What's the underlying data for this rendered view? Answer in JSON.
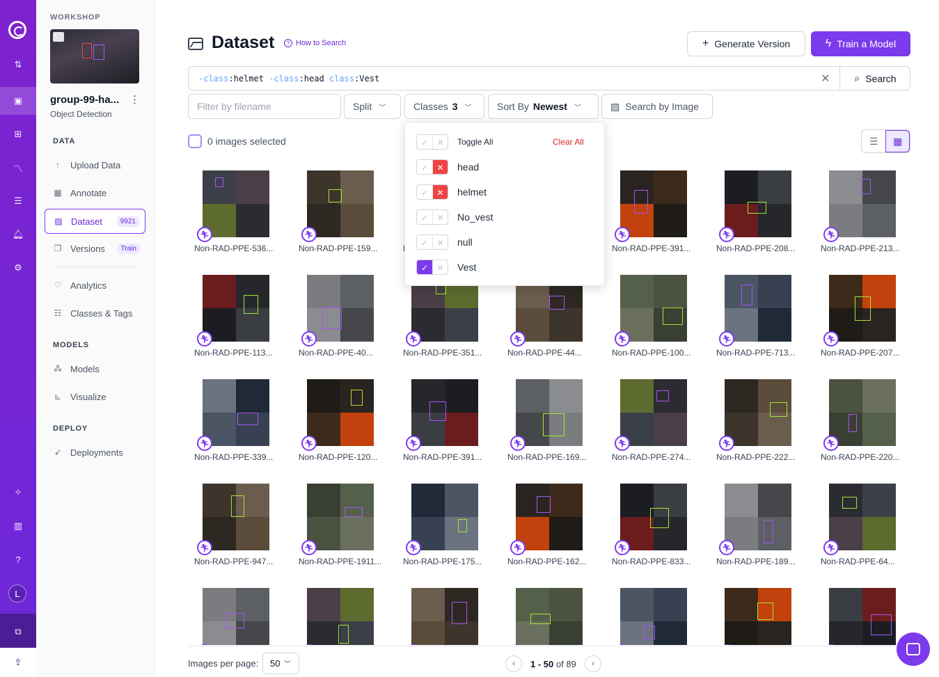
{
  "workspace": {
    "label": "WORKSHOP",
    "project_name": "group-99-ha...",
    "project_type": "Object Detection",
    "avatar_letter": "L"
  },
  "sidebar": {
    "data_section": "DATA",
    "models_section": "MODELS",
    "deploy_section": "DEPLOY",
    "items": [
      {
        "label": "Upload Data",
        "icon": "upload-icon"
      },
      {
        "label": "Annotate",
        "icon": "annotate-icon"
      },
      {
        "label": "Dataset",
        "icon": "dataset-icon",
        "badge": "9921"
      },
      {
        "label": "Versions",
        "icon": "versions-icon",
        "badge": "Train"
      },
      {
        "label": "Analytics",
        "icon": "analytics-icon"
      },
      {
        "label": "Classes & Tags",
        "icon": "list-icon"
      },
      {
        "label": "Models",
        "icon": "models-icon"
      },
      {
        "label": "Visualize",
        "icon": "chart-icon"
      },
      {
        "label": "Deployments",
        "icon": "rocket-icon"
      }
    ]
  },
  "header": {
    "title": "Dataset",
    "how_to_search": "How to Search",
    "generate_version": "Generate Version",
    "train_model": "Train a Model"
  },
  "search": {
    "query_tokens": [
      {
        "key": "-class",
        "value": "helmet"
      },
      {
        "key": "-class",
        "value": "head"
      },
      {
        "key": "class",
        "value": "Vest"
      }
    ],
    "button": "Search"
  },
  "filters": {
    "filename_placeholder": "Filter by filename",
    "split": "Split",
    "classes": "Classes",
    "classes_count": "3",
    "sort_by": "Sort By",
    "sort_value": "Newest",
    "search_by_image": "Search by Image"
  },
  "selection": {
    "text": "0 images selected"
  },
  "classes_dropdown": {
    "toggle_all": "Toggle All",
    "clear_all": "Clear All",
    "items": [
      {
        "name": "head",
        "state": "exclude"
      },
      {
        "name": "helmet",
        "state": "exclude"
      },
      {
        "name": "No_vest",
        "state": "none"
      },
      {
        "name": "null",
        "state": "none"
      },
      {
        "name": "Vest",
        "state": "include"
      }
    ]
  },
  "images": [
    "Non-RAD-PPE-536...",
    "Non-RAD-PPE-159...",
    "Non-RAD-PPE-...",
    "Non-RAD-PPE-...",
    "Non-RAD-PPE-391...",
    "Non-RAD-PPE-208...",
    "Non-RAD-PPE-213...",
    "Non-RAD-PPE-113...",
    "Non-RAD-PPE-40...",
    "Non-RAD-PPE-351...",
    "Non-RAD-PPE-44...",
    "Non-RAD-PPE-100...",
    "Non-RAD-PPE-713...",
    "Non-RAD-PPE-207...",
    "Non-RAD-PPE-339...",
    "Non-RAD-PPE-120...",
    "Non-RAD-PPE-391...",
    "Non-RAD-PPE-169...",
    "Non-RAD-PPE-274...",
    "Non-RAD-PPE-222...",
    "Non-RAD-PPE-220...",
    "Non-RAD-PPE-947...",
    "Non-RAD-PPE-1911...",
    "Non-RAD-PPE-175...",
    "Non-RAD-PPE-162...",
    "Non-RAD-PPE-833...",
    "Non-RAD-PPE-189...",
    "Non-RAD-PPE-64...",
    "",
    "",
    "",
    "",
    "",
    "",
    ""
  ],
  "pagination": {
    "per_page_label": "Images per page:",
    "per_page": "50",
    "range": "1 - 50",
    "of_text": "of 89"
  },
  "colors": {
    "accent": "#7c3aed",
    "exclude": "#ef4444"
  }
}
